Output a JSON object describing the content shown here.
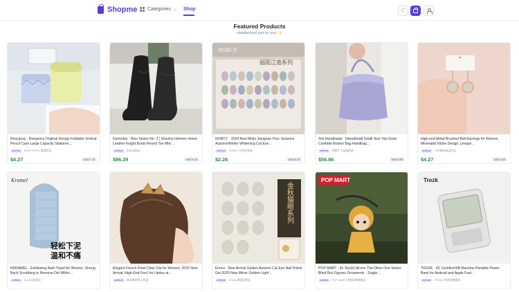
{
  "header": {
    "brand": "Shopme",
    "categories_label": "Categories",
    "shop_label": "Shop"
  },
  "section": {
    "title": "Featured Products",
    "subtitle": "Handpicked just for you"
  },
  "products": [
    {
      "title": "Rosyposy · Rosyposy Original Design Foldable Vertical Pencil Case Large Capacity Stationer…",
      "badge": "redNote",
      "seller": "ROSY POSY 柔丝的包",
      "price": "$4.27",
      "sold": "Sold 7.1k"
    },
    {
      "title": "Dunlvdao · Biye Series No. 2 | Slouchy Hermes Horse Leather Knight Boots Round Toe Mid-…",
      "badge": "redNote",
      "seller": "毕业坊的店",
      "price": "$96.29",
      "sold": "Sold 6.1k"
    },
    {
      "title": "NORCY · 2024 New Misty Jiangnan Four Seasons Autumn/Winter Whitening Cat Eye…",
      "badge": "redNote",
      "seller": "NORCY 中西方的店",
      "price": "$2.26",
      "sold": "Sold 5.4k"
    },
    {
      "title": "Sixi Handmade · [Heartbeat] Small Size Top-Grain Cowhide Boston Bag Handbag…",
      "badge": "redNote",
      "seller": "四喜手工皮具的店",
      "price": "$56.86",
      "sold": "Sold 6.8k"
    },
    {
      "title": "High-end Metal Brushed Ball Earrings for Women, Minimalist Niche Design, Unique…",
      "badge": "redNote",
      "seller": "小竹棒的饰品的店",
      "price": "$4.27",
      "sold": "Sold 5.4k"
    },
    {
      "title": "KRRAMEL · Exfoliating Bath Towel for Women, Strong Back Scrubbing to Remove Dirt Witho…",
      "badge": "redNote",
      "seller": "Kramel家居坊",
      "price": "",
      "sold": ""
    },
    {
      "title": "Elegant French Petal Claw Clip for Women, 2025 New Arrival, High-End Feel, for Updos at…",
      "badge": "redNote",
      "seller": "林木雅发饰 ● 优选",
      "price": "",
      "sold": ""
    },
    {
      "title": "Ennisi · New Arrival Golden Autumn Cat Eye Nail Polish Gel 2025 New Mirror Golden Light…",
      "badge": "redNote",
      "seller": "Ennisi 恩妮丝的店",
      "price": "",
      "sold": ""
    },
    {
      "title": "POP MART · [In Stock] Hirono The Other One Series Blind Box Figures Ornaments · Single…",
      "badge": "redNote",
      "seller": "POP MART 泡泡玛特旗舰店",
      "price": "",
      "sold": ""
    },
    {
      "title": "TROZK · 3C Certified BB Machine Portable Power Bank for Android and Apple Fast…",
      "badge": "redNote",
      "seller": "TROZK 特洛克旗舰店",
      "price": "",
      "sold": ""
    }
  ],
  "image_text": {
    "norcy_brand": "NORCY",
    "norcy_cn": "烟雨江南系列",
    "kramel_brand": "Kramel",
    "kramel_cn1": "轻松下泥",
    "kramel_cn2": "温和不痛",
    "ennisi_cn": "金秋猫眼系列",
    "popmart_brand": "POP MART",
    "trozk_brand": "Trozk"
  },
  "colors": {
    "accent": "#5b3bd8",
    "price": "#2b8a4a"
  }
}
